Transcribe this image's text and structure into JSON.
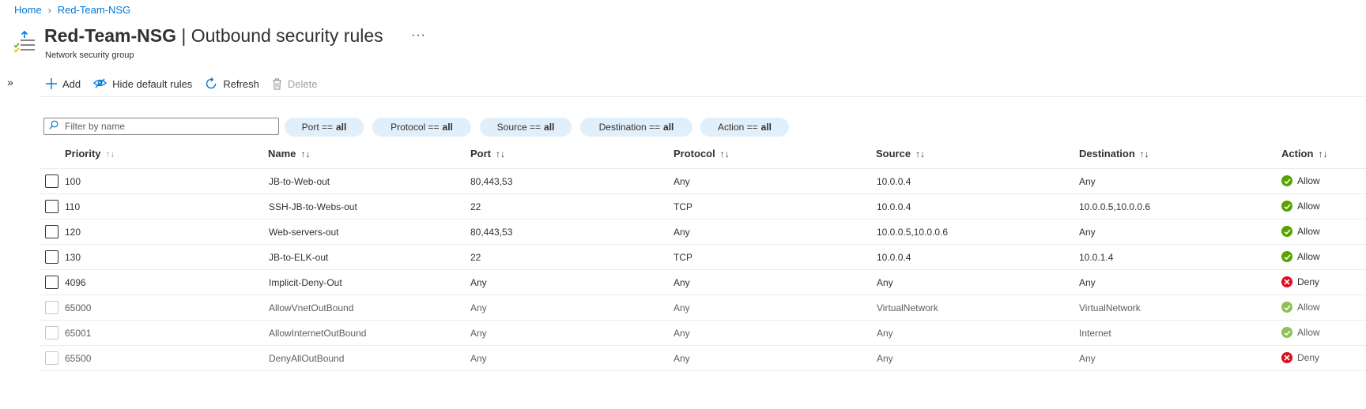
{
  "breadcrumb": {
    "home": "Home",
    "current": "Red-Team-NSG"
  },
  "header": {
    "title_main": "Red-Team-NSG",
    "title_rest": " | Outbound security rules",
    "ellipsis": "···",
    "subtitle": "Network security group",
    "expand": "»"
  },
  "toolbar": {
    "add": "Add",
    "hide_default": "Hide default rules",
    "refresh": "Refresh",
    "delete": "Delete"
  },
  "filters": {
    "placeholder": "Filter by name",
    "pills": [
      {
        "key": "Port ==",
        "value": "all"
      },
      {
        "key": "Protocol ==",
        "value": "all"
      },
      {
        "key": "Source ==",
        "value": "all"
      },
      {
        "key": "Destination ==",
        "value": "all"
      },
      {
        "key": "Action ==",
        "value": "all"
      }
    ]
  },
  "table": {
    "columns": [
      "Priority",
      "Name",
      "Port",
      "Protocol",
      "Source",
      "Destination",
      "Action"
    ],
    "sort_glyph": "↑↓",
    "rows": [
      {
        "priority": "100",
        "name": "JB-to-Web-out",
        "port": "80,443,53",
        "protocol": "Any",
        "source": "10.0.0.4",
        "destination": "Any",
        "action": "Allow"
      },
      {
        "priority": "110",
        "name": "SSH-JB-to-Webs-out",
        "port": "22",
        "protocol": "TCP",
        "source": "10.0.0.4",
        "destination": "10.0.0.5,10.0.0.6",
        "action": "Allow"
      },
      {
        "priority": "120",
        "name": "Web-servers-out",
        "port": "80,443,53",
        "protocol": "Any",
        "source": "10.0.0.5,10.0.0.6",
        "destination": "Any",
        "action": "Allow"
      },
      {
        "priority": "130",
        "name": "JB-to-ELK-out",
        "port": "22",
        "protocol": "TCP",
        "source": "10.0.0.4",
        "destination": "10.0.1.4",
        "action": "Allow"
      },
      {
        "priority": "4096",
        "name": "Implicit-Deny-Out",
        "port": "Any",
        "protocol": "Any",
        "source": "Any",
        "destination": "Any",
        "action": "Deny"
      },
      {
        "priority": "65000",
        "name": "AllowVnetOutBound",
        "port": "Any",
        "protocol": "Any",
        "source": "VirtualNetwork",
        "destination": "VirtualNetwork",
        "action": "Allow"
      },
      {
        "priority": "65001",
        "name": "AllowInternetOutBound",
        "port": "Any",
        "protocol": "Any",
        "source": "Any",
        "destination": "Internet",
        "action": "Allow"
      },
      {
        "priority": "65500",
        "name": "DenyAllOutBound",
        "port": "Any",
        "protocol": "Any",
        "source": "Any",
        "destination": "Any",
        "action": "Deny"
      }
    ]
  },
  "colors": {
    "link": "#0078d4",
    "allow": "#57a300",
    "deny": "#e00b1c",
    "pill_bg": "#e1effa"
  }
}
